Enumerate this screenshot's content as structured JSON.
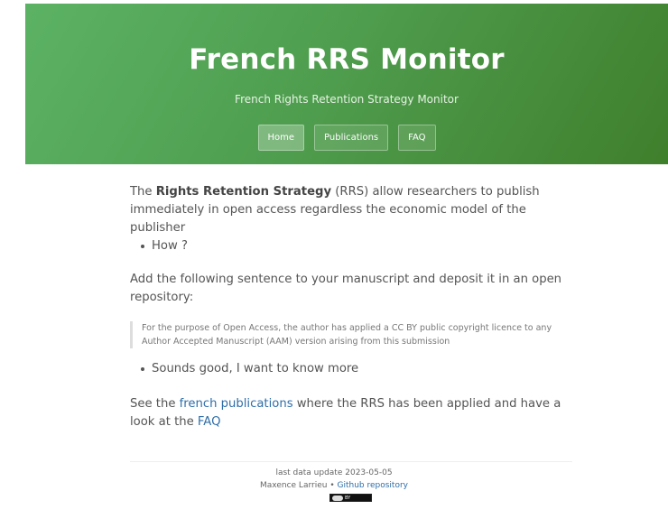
{
  "header": {
    "title": "French RRS Monitor",
    "subtitle": "French Rights Retention Strategy Monitor",
    "nav": [
      "Home",
      "Publications",
      "FAQ"
    ]
  },
  "intro": {
    "before": "The ",
    "bold": "Rights Retention Strategy",
    "after": " (RRS) allow researchers to publish immediately in open access regardless the economic model of the publisher"
  },
  "bullets": [
    "How ?",
    "Sounds good, I want to know more"
  ],
  "instruction": "Add the following sentence to your manuscript and deposit it in an open repository:",
  "quote": "For the purpose of Open Access, the author has applied a CC BY public copyright licence to any Author Accepted Manuscript (AAM) version arising from this submission",
  "see_also": {
    "pre": "See the ",
    "link1": "french publications",
    "mid": " where the RRS has been applied and have a look at the ",
    "link2": "FAQ"
  },
  "footer": {
    "update": "last data update 2023-05-05",
    "author": "Maxence Larrieu",
    "separator": " • ",
    "repo": "Github repository",
    "license_badge": "BY"
  }
}
